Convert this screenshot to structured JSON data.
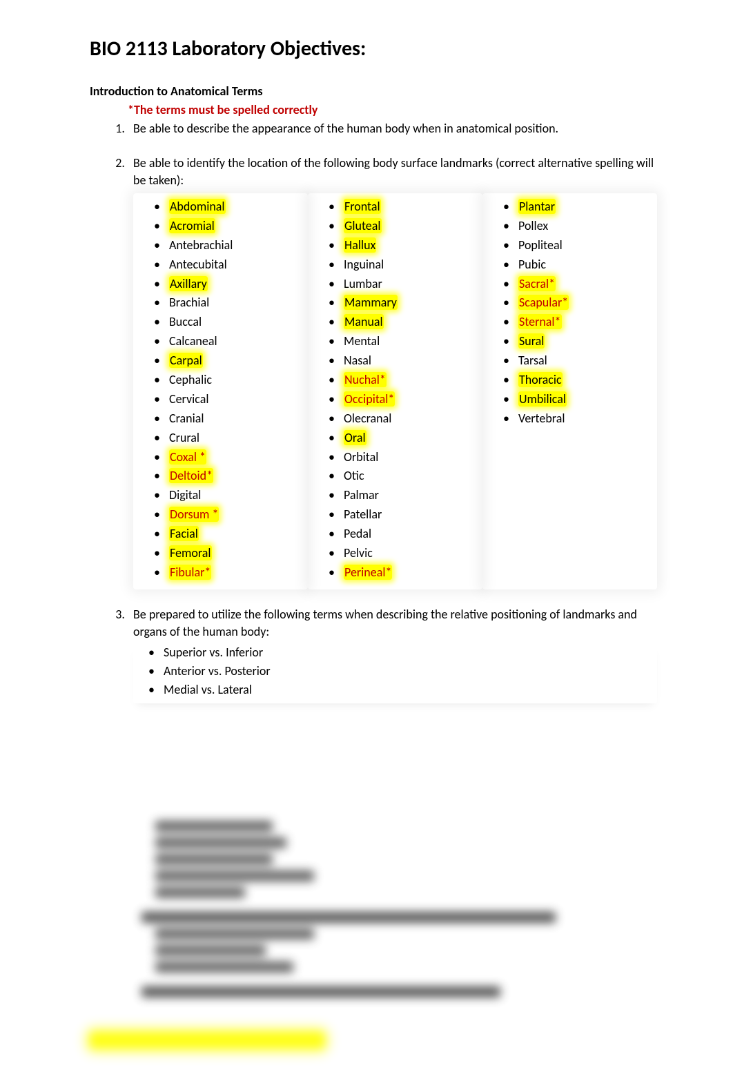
{
  "title": "BIO 2113 Laboratory Objectives:",
  "section_heading": "Introduction to Anatomical Terms",
  "spelling_note": "*The terms must be spelled correctly",
  "objectives": {
    "o1": "Be able to describe the appearance of the human body when in anatomical position.",
    "o2": "Be able to identify the location of the following body surface landmarks (correct alternative spelling will be taken):",
    "o3": "Be prepared to utilize the following terms when describing the relative positioning of landmarks and organs of the human body:"
  },
  "landmarks": {
    "col1": [
      {
        "t": "Abdominal",
        "hl": true,
        "red": false
      },
      {
        "t": "Acromial",
        "hl": true,
        "red": false
      },
      {
        "t": "Antebrachial",
        "hl": false,
        "red": false
      },
      {
        "t": "Antecubital",
        "hl": false,
        "red": false
      },
      {
        "t": "Axillary",
        "hl": true,
        "red": false
      },
      {
        "t": "Brachial",
        "hl": false,
        "red": false
      },
      {
        "t": "Buccal",
        "hl": false,
        "red": false
      },
      {
        "t": "Calcaneal",
        "hl": false,
        "red": false
      },
      {
        "t": "Carpal",
        "hl": true,
        "red": false
      },
      {
        "t": "Cephalic",
        "hl": false,
        "red": false
      },
      {
        "t": "Cervical",
        "hl": false,
        "red": false
      },
      {
        "t": "Cranial",
        "hl": false,
        "red": false
      },
      {
        "t": "Crural",
        "hl": false,
        "red": false
      },
      {
        "t": "Coxal *",
        "hl": true,
        "red": true
      },
      {
        "t": "Deltoid*",
        "hl": true,
        "red": true
      },
      {
        "t": "Digital",
        "hl": false,
        "red": false
      },
      {
        "t": "Dorsum *",
        "hl": true,
        "red": true
      },
      {
        "t": "Facial",
        "hl": true,
        "red": false
      },
      {
        "t": "Femoral",
        "hl": true,
        "red": false
      },
      {
        "t": "Fibular*",
        "hl": true,
        "red": true
      }
    ],
    "col2": [
      {
        "t": "Frontal",
        "hl": true,
        "red": false
      },
      {
        "t": "Gluteal",
        "hl": true,
        "red": false
      },
      {
        "t": "Hallux",
        "hl": true,
        "red": false
      },
      {
        "t": "Inguinal",
        "hl": false,
        "red": false
      },
      {
        "t": "Lumbar",
        "hl": false,
        "red": false
      },
      {
        "t": "Mammary",
        "hl": true,
        "red": false
      },
      {
        "t": "Manual",
        "hl": true,
        "red": false
      },
      {
        "t": "Mental",
        "hl": false,
        "red": false
      },
      {
        "t": "Nasal",
        "hl": false,
        "red": false
      },
      {
        "t": "Nuchal*",
        "hl": true,
        "red": true
      },
      {
        "t": "Occipital*",
        "hl": true,
        "red": true
      },
      {
        "t": "Olecranal",
        "hl": false,
        "red": false
      },
      {
        "t": "Oral",
        "hl": true,
        "red": false
      },
      {
        "t": "Orbital",
        "hl": false,
        "red": false
      },
      {
        "t": "Otic",
        "hl": false,
        "red": false
      },
      {
        "t": "Palmar",
        "hl": false,
        "red": false
      },
      {
        "t": "Patellar",
        "hl": false,
        "red": false
      },
      {
        "t": "Pedal",
        "hl": false,
        "red": false
      },
      {
        "t": "Pelvic",
        "hl": false,
        "red": false
      },
      {
        "t": "Perineal*",
        "hl": true,
        "red": true
      }
    ],
    "col3": [
      {
        "t": "Plantar",
        "hl": true,
        "red": false
      },
      {
        "t": "Pollex",
        "hl": false,
        "red": false
      },
      {
        "t": "Popliteal",
        "hl": false,
        "red": false
      },
      {
        "t": "Pubic",
        "hl": false,
        "red": false
      },
      {
        "t": "Sacral*",
        "hl": true,
        "red": true
      },
      {
        "t": "Scapular*",
        "hl": true,
        "red": true
      },
      {
        "t": "Sternal*",
        "hl": true,
        "red": true
      },
      {
        "t": "Sural",
        "hl": true,
        "red": false
      },
      {
        "t": "Tarsal",
        "hl": false,
        "red": false
      },
      {
        "t": "Thoracic",
        "hl": true,
        "red": false
      },
      {
        "t": "Umbilical",
        "hl": true,
        "red": false
      },
      {
        "t": "Vertebral",
        "hl": false,
        "red": false
      }
    ]
  },
  "positioning_terms": [
    "Superior vs. Inferior",
    "Anterior vs. Posterior",
    "Medial  vs. Lateral"
  ]
}
